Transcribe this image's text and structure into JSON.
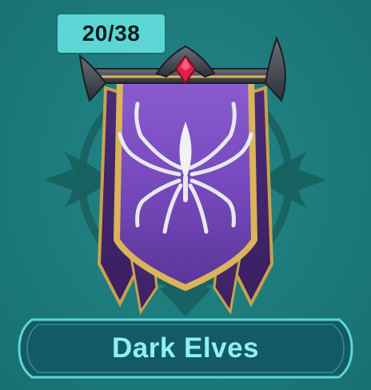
{
  "faction": {
    "progress_text": "20/38",
    "name": "Dark Elves",
    "icon": "spider-banner-icon"
  },
  "colors": {
    "background": "#1c7a7a",
    "badge": "#5cd6d4",
    "banner_purple": "#7a4fc0",
    "banner_trim": "#d9b45a",
    "name_text": "#8ff0f0",
    "plate_fill": "#135a66",
    "plate_border": "#5cd6d4",
    "gem": "#e0204a"
  }
}
